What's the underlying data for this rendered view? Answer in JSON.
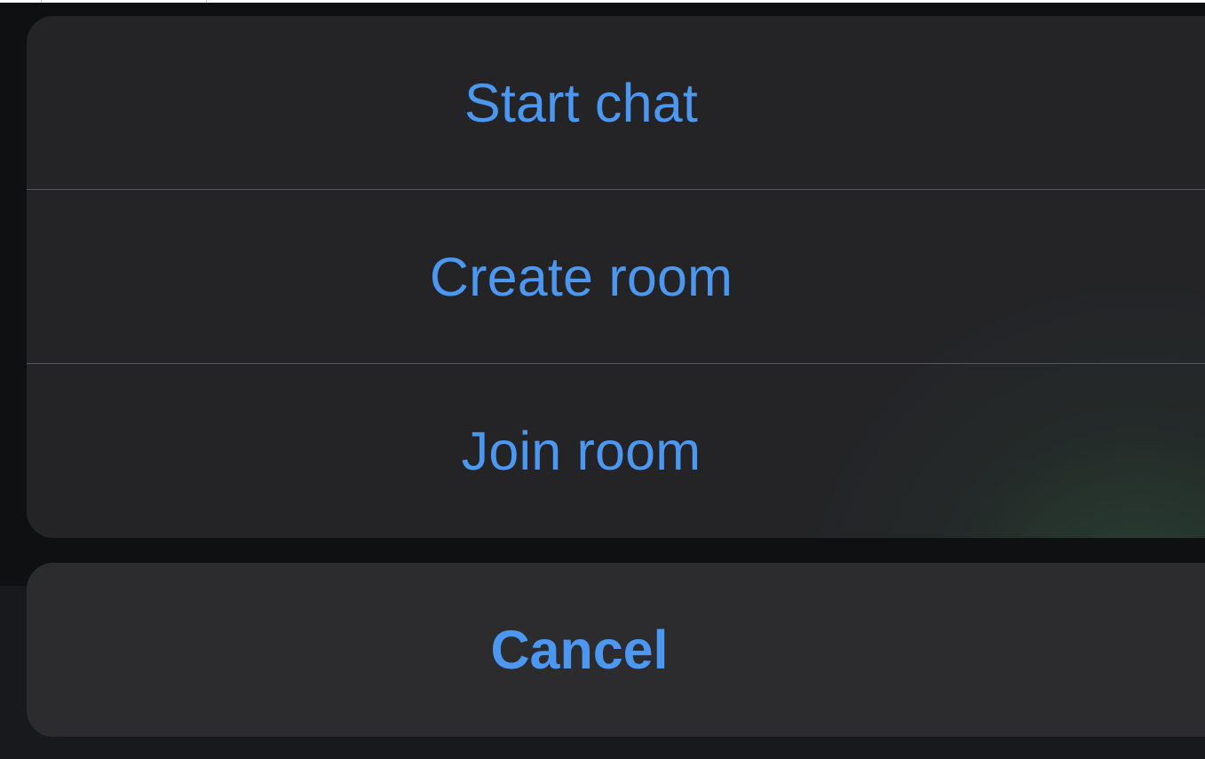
{
  "action_sheet": {
    "actions": [
      {
        "label": "Start chat"
      },
      {
        "label": "Create room"
      },
      {
        "label": "Join room"
      }
    ],
    "cancel_label": "Cancel"
  },
  "colors": {
    "accent": "#4c97f0",
    "sheet_background": "#242427",
    "cancel_background": "#2c2c2f",
    "divider": "#58585c",
    "backdrop": "#0f1012"
  }
}
